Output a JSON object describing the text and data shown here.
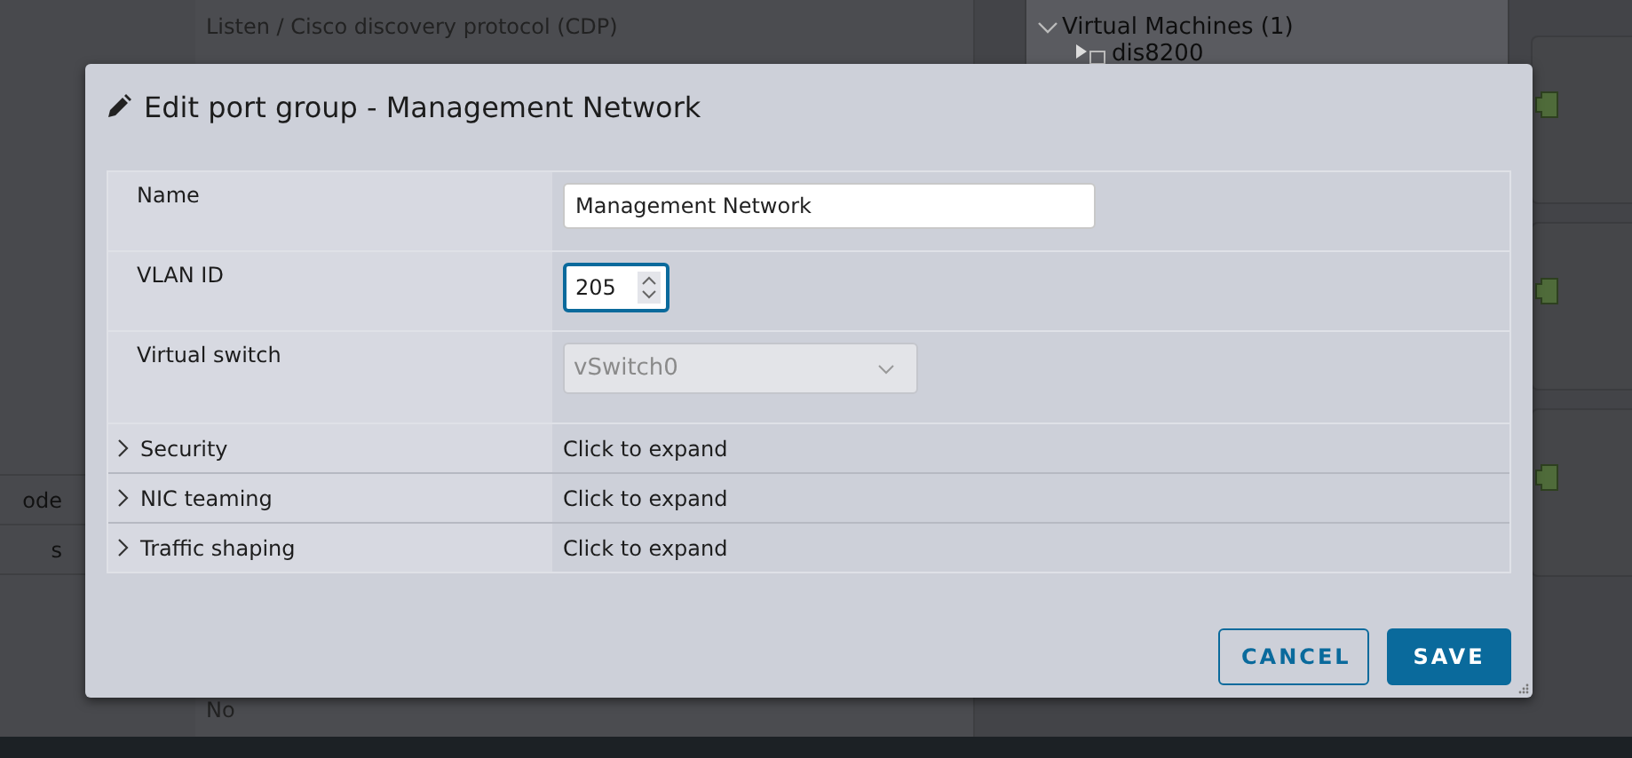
{
  "background": {
    "left_rows": [
      "ode",
      "s"
    ],
    "middle_rows": [
      "Listen / Cisco discovery protocol (CDP)",
      "No"
    ],
    "tree": {
      "group": {
        "label": "Virtual Machines (1)",
        "expanded": true,
        "children": [
          {
            "label": "dis8200"
          }
        ]
      }
    }
  },
  "dialog": {
    "title": "Edit port group - Management Network",
    "fields": [
      {
        "kind": "text",
        "label": "Name",
        "value": "Management Network"
      },
      {
        "kind": "number",
        "label": "VLAN ID",
        "value": "205",
        "focused": true
      },
      {
        "kind": "select",
        "label": "Virtual switch",
        "value": "vSwitch0",
        "disabled": true
      },
      {
        "kind": "section",
        "label": "Security",
        "value": "Click to expand",
        "expanded": false
      },
      {
        "kind": "section",
        "label": "NIC teaming",
        "value": "Click to expand",
        "expanded": false
      },
      {
        "kind": "section",
        "label": "Traffic shaping",
        "value": "Click to expand",
        "expanded": false
      }
    ],
    "buttons": [
      {
        "kind": "secondary",
        "label": "CANCEL"
      },
      {
        "kind": "primary",
        "label": "SAVE"
      }
    ]
  }
}
